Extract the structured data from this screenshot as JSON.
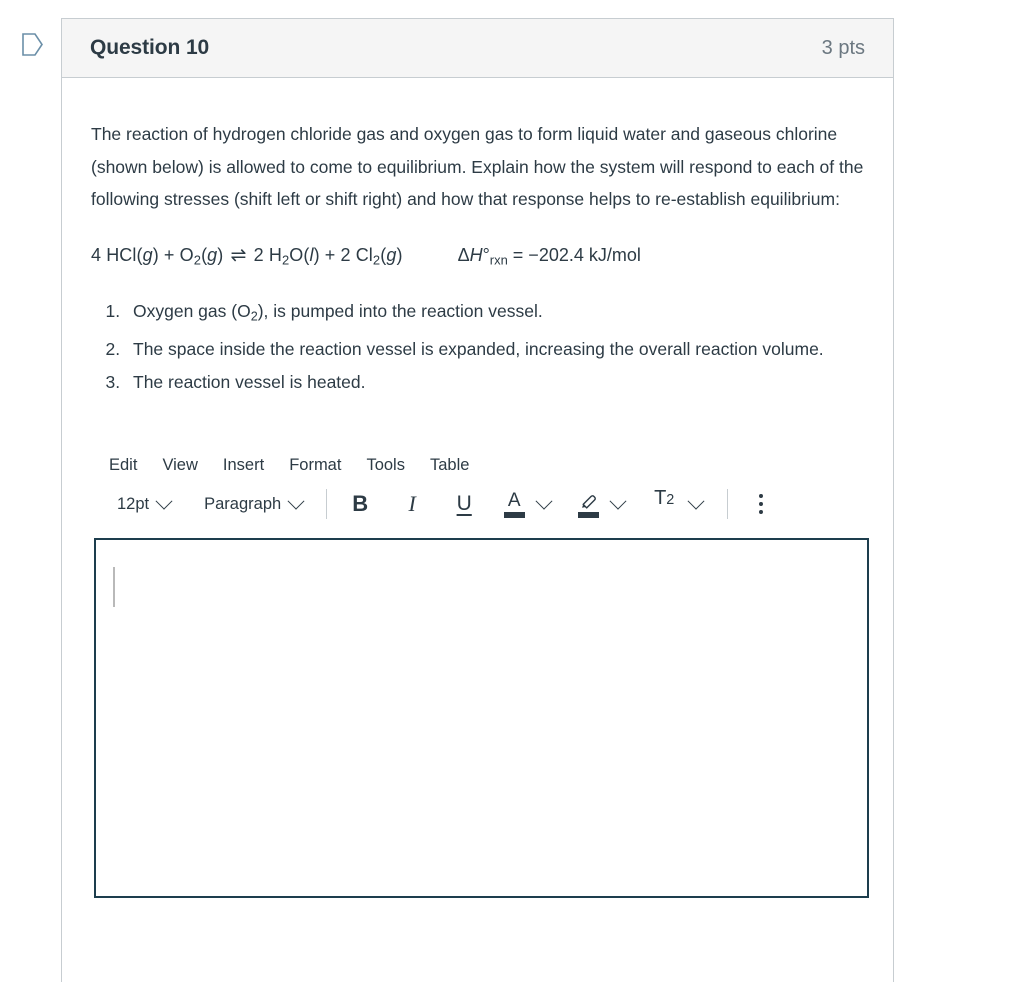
{
  "gutter": {
    "flag_icon": "bookmark-flag-icon"
  },
  "question": {
    "title": "Question 10",
    "points": "3 pts",
    "prompt": "The reaction of hydrogen chloride gas and oxygen gas to form liquid water and gaseous chlorine (shown below) is allowed to come to equilibrium. Explain how the system will respond to each of the following stresses (shift left or shift right) and how that response helps to re-establish equilibrium:",
    "equation": {
      "full_text": "4 HCl(g) + O2(g) ⇌ 2 H2O(l) + 2 Cl2(g)",
      "reactant_coefficient_1": "4 HCl(",
      "reactant_state_1": "g",
      "plus_1": ") + O",
      "reactant_sub_2": "2",
      "reactant_state_2": "g",
      "arrow": "⇌",
      "product_coefficient_1": "2 H",
      "product_sub_1": "2",
      "product_mid_1": "O(",
      "product_state_1": "l",
      "plus_2": ") + 2 Cl",
      "product_sub_2": "2",
      "product_state_2": "g",
      "close": ")",
      "enthalpy_delta": "Δ",
      "enthalpy_h": "H",
      "enthalpy_degree": "°",
      "enthalpy_sub": "rxn",
      "enthalpy_value": " = −202.4 kJ/mol"
    },
    "stresses": [
      "Oxygen gas (O2), is pumped into the reaction vessel.",
      "The space inside the reaction vessel is expanded, increasing the overall reaction volume.",
      "The reaction vessel is heated."
    ],
    "stress_parts": {
      "item1_before": "Oxygen gas (O",
      "item1_sub": "2",
      "item1_after": "), is pumped into the reaction vessel.",
      "item2": "The space inside the reaction vessel is expanded, increasing the overall reaction volume.",
      "item3": "The reaction vessel is heated."
    }
  },
  "editor": {
    "menubar": [
      {
        "label": "Edit"
      },
      {
        "label": "View"
      },
      {
        "label": "Insert"
      },
      {
        "label": "Format"
      },
      {
        "label": "Tools"
      },
      {
        "label": "Table"
      }
    ],
    "toolbar": {
      "font_size": "12pt",
      "block_format": "Paragraph",
      "bold": "B",
      "italic": "I",
      "underline": "U",
      "text_color_glyph": "A",
      "highlight_icon": "highlighter-icon",
      "superscript_glyph": "T",
      "superscript_exponent": "2",
      "more_options": "more-options-icon"
    },
    "content": "",
    "placeholder": ""
  },
  "colors": {
    "card_border": "#c7cdd1",
    "header_bg": "#f5f5f5",
    "text": "#2d3b45",
    "muted_text": "#6b7780",
    "editor_border": "#1d3d4d",
    "flag_outline": "#6b8fa8"
  }
}
